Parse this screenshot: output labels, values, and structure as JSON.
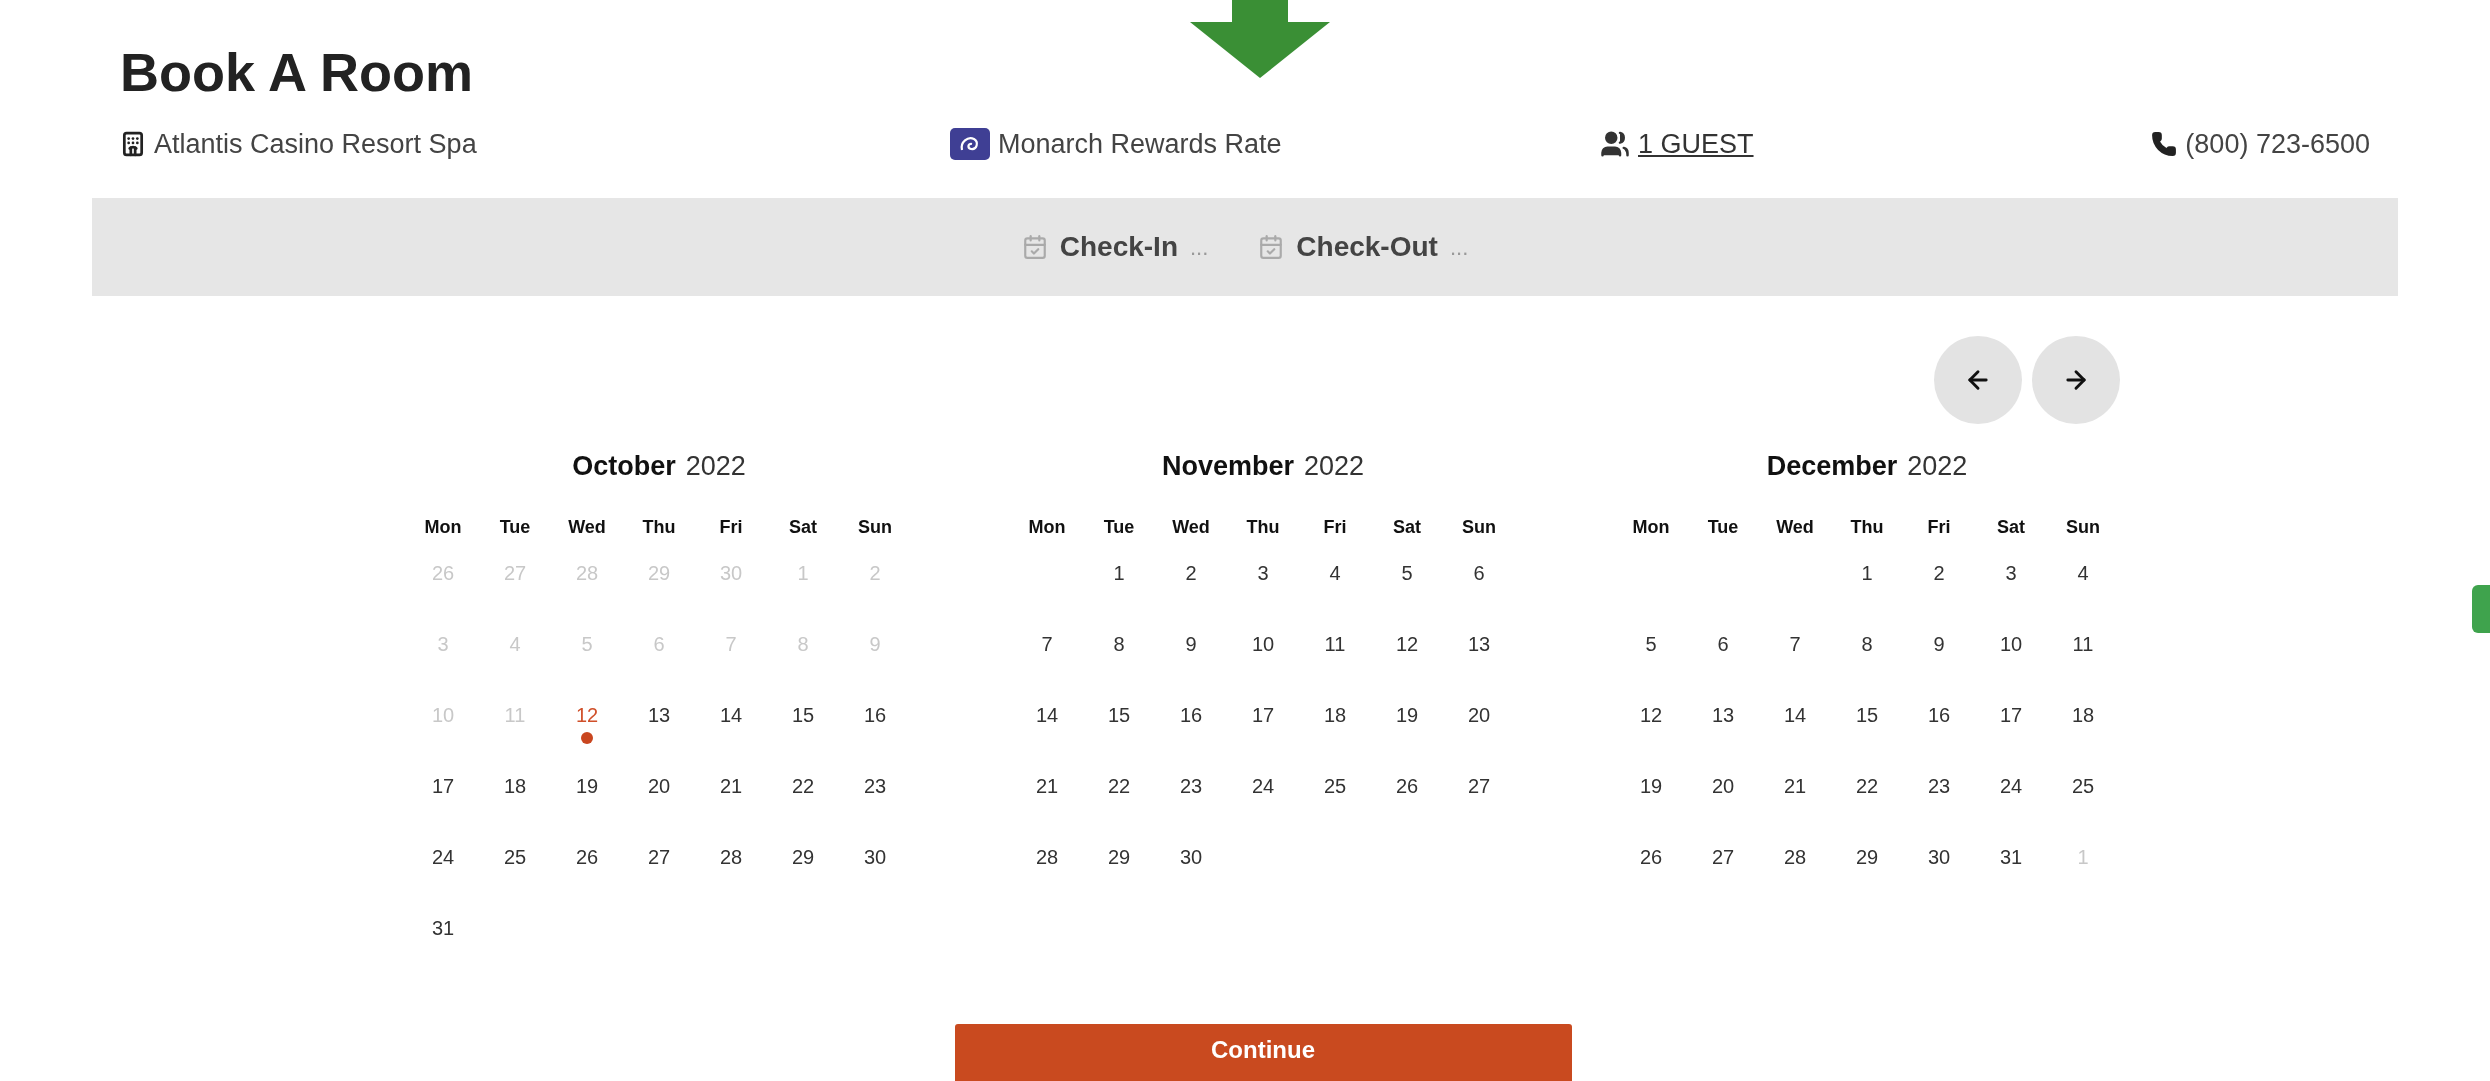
{
  "title": "Book A Room",
  "info": [
    {
      "kind": "hotel",
      "text": "Atlantis Casino Resort Spa"
    },
    {
      "kind": "rate",
      "text": "Monarch Rewards Rate"
    },
    {
      "kind": "guests",
      "text": "1 GUEST"
    },
    {
      "kind": "phone",
      "text": "(800) 723-6500"
    }
  ],
  "dates": [
    {
      "label": "Check-In",
      "value": "..."
    },
    {
      "label": "Check-Out",
      "value": "..."
    }
  ],
  "months": [
    {
      "month": "October",
      "year": "2022",
      "weekdays": [
        "Mon",
        "Tue",
        "Wed",
        "Thu",
        "Fri",
        "Sat",
        "Sun"
      ],
      "weeks": [
        [
          {
            "label": "26",
            "kind": "disabled"
          },
          {
            "label": "27",
            "kind": "disabled"
          },
          {
            "label": "28",
            "kind": "disabled"
          },
          {
            "label": "29",
            "kind": "disabled"
          },
          {
            "label": "30",
            "kind": "disabled"
          },
          {
            "label": "1",
            "kind": "disabled"
          },
          {
            "label": "2",
            "kind": "disabled"
          }
        ],
        [
          {
            "label": "3",
            "kind": "disabled"
          },
          {
            "label": "4",
            "kind": "disabled"
          },
          {
            "label": "5",
            "kind": "disabled"
          },
          {
            "label": "6",
            "kind": "disabled"
          },
          {
            "label": "7",
            "kind": "disabled"
          },
          {
            "label": "8",
            "kind": "disabled"
          },
          {
            "label": "9",
            "kind": "disabled"
          }
        ],
        [
          {
            "label": "10",
            "kind": "disabled"
          },
          {
            "label": "11",
            "kind": "disabled"
          },
          {
            "label": "12",
            "kind": "today"
          },
          {
            "label": "13",
            "kind": "open"
          },
          {
            "label": "14",
            "kind": "open"
          },
          {
            "label": "15",
            "kind": "open"
          },
          {
            "label": "16",
            "kind": "open"
          }
        ],
        [
          {
            "label": "17",
            "kind": "open"
          },
          {
            "label": "18",
            "kind": "open"
          },
          {
            "label": "19",
            "kind": "open"
          },
          {
            "label": "20",
            "kind": "open"
          },
          {
            "label": "21",
            "kind": "open"
          },
          {
            "label": "22",
            "kind": "open"
          },
          {
            "label": "23",
            "kind": "open"
          }
        ],
        [
          {
            "label": "24",
            "kind": "open"
          },
          {
            "label": "25",
            "kind": "open"
          },
          {
            "label": "26",
            "kind": "open"
          },
          {
            "label": "27",
            "kind": "open"
          },
          {
            "label": "28",
            "kind": "open"
          },
          {
            "label": "29",
            "kind": "open"
          },
          {
            "label": "30",
            "kind": "open"
          }
        ],
        [
          {
            "label": "31",
            "kind": "open"
          }
        ]
      ]
    },
    {
      "month": "November",
      "year": "2022",
      "weekdays": [
        "Mon",
        "Tue",
        "Wed",
        "Thu",
        "Fri",
        "Sat",
        "Sun"
      ],
      "weeks": [
        [
          {
            "kind": "blank"
          },
          {
            "label": "1",
            "kind": "open"
          },
          {
            "label": "2",
            "kind": "open"
          },
          {
            "label": "3",
            "kind": "open"
          },
          {
            "label": "4",
            "kind": "open"
          },
          {
            "label": "5",
            "kind": "open"
          },
          {
            "label": "6",
            "kind": "open"
          }
        ],
        [
          {
            "label": "7",
            "kind": "open"
          },
          {
            "label": "8",
            "kind": "open"
          },
          {
            "label": "9",
            "kind": "open"
          },
          {
            "label": "10",
            "kind": "open"
          },
          {
            "label": "11",
            "kind": "open"
          },
          {
            "label": "12",
            "kind": "open"
          },
          {
            "label": "13",
            "kind": "open"
          }
        ],
        [
          {
            "label": "14",
            "kind": "open"
          },
          {
            "label": "15",
            "kind": "open"
          },
          {
            "label": "16",
            "kind": "open"
          },
          {
            "label": "17",
            "kind": "open"
          },
          {
            "label": "18",
            "kind": "open"
          },
          {
            "label": "19",
            "kind": "open"
          },
          {
            "label": "20",
            "kind": "open"
          }
        ],
        [
          {
            "label": "21",
            "kind": "open"
          },
          {
            "label": "22",
            "kind": "open"
          },
          {
            "label": "23",
            "kind": "open"
          },
          {
            "label": "24",
            "kind": "open"
          },
          {
            "label": "25",
            "kind": "open"
          },
          {
            "label": "26",
            "kind": "open"
          },
          {
            "label": "27",
            "kind": "open"
          }
        ],
        [
          {
            "label": "28",
            "kind": "open"
          },
          {
            "label": "29",
            "kind": "open"
          },
          {
            "label": "30",
            "kind": "open"
          }
        ]
      ]
    },
    {
      "month": "December",
      "year": "2022",
      "weekdays": [
        "Mon",
        "Tue",
        "Wed",
        "Thu",
        "Fri",
        "Sat",
        "Sun"
      ],
      "weeks": [
        [
          {
            "kind": "blank"
          },
          {
            "kind": "blank"
          },
          {
            "kind": "blank"
          },
          {
            "label": "1",
            "kind": "open"
          },
          {
            "label": "2",
            "kind": "open"
          },
          {
            "label": "3",
            "kind": "open"
          },
          {
            "label": "4",
            "kind": "open"
          }
        ],
        [
          {
            "label": "5",
            "kind": "open"
          },
          {
            "label": "6",
            "kind": "open"
          },
          {
            "label": "7",
            "kind": "open"
          },
          {
            "label": "8",
            "kind": "open"
          },
          {
            "label": "9",
            "kind": "open"
          },
          {
            "label": "10",
            "kind": "open"
          },
          {
            "label": "11",
            "kind": "open"
          }
        ],
        [
          {
            "label": "12",
            "kind": "open"
          },
          {
            "label": "13",
            "kind": "open"
          },
          {
            "label": "14",
            "kind": "open"
          },
          {
            "label": "15",
            "kind": "open"
          },
          {
            "label": "16",
            "kind": "open"
          },
          {
            "label": "17",
            "kind": "open"
          },
          {
            "label": "18",
            "kind": "open"
          }
        ],
        [
          {
            "label": "19",
            "kind": "open"
          },
          {
            "label": "20",
            "kind": "open"
          },
          {
            "label": "21",
            "kind": "open"
          },
          {
            "label": "22",
            "kind": "open"
          },
          {
            "label": "23",
            "kind": "open"
          },
          {
            "label": "24",
            "kind": "open"
          },
          {
            "label": "25",
            "kind": "open"
          }
        ],
        [
          {
            "label": "26",
            "kind": "open"
          },
          {
            "label": "27",
            "kind": "open"
          },
          {
            "label": "28",
            "kind": "open"
          },
          {
            "label": "29",
            "kind": "open"
          },
          {
            "label": "30",
            "kind": "open"
          },
          {
            "label": "31",
            "kind": "open"
          },
          {
            "label": "1",
            "kind": "disabled"
          }
        ]
      ]
    }
  ],
  "continue_button": "Continue"
}
